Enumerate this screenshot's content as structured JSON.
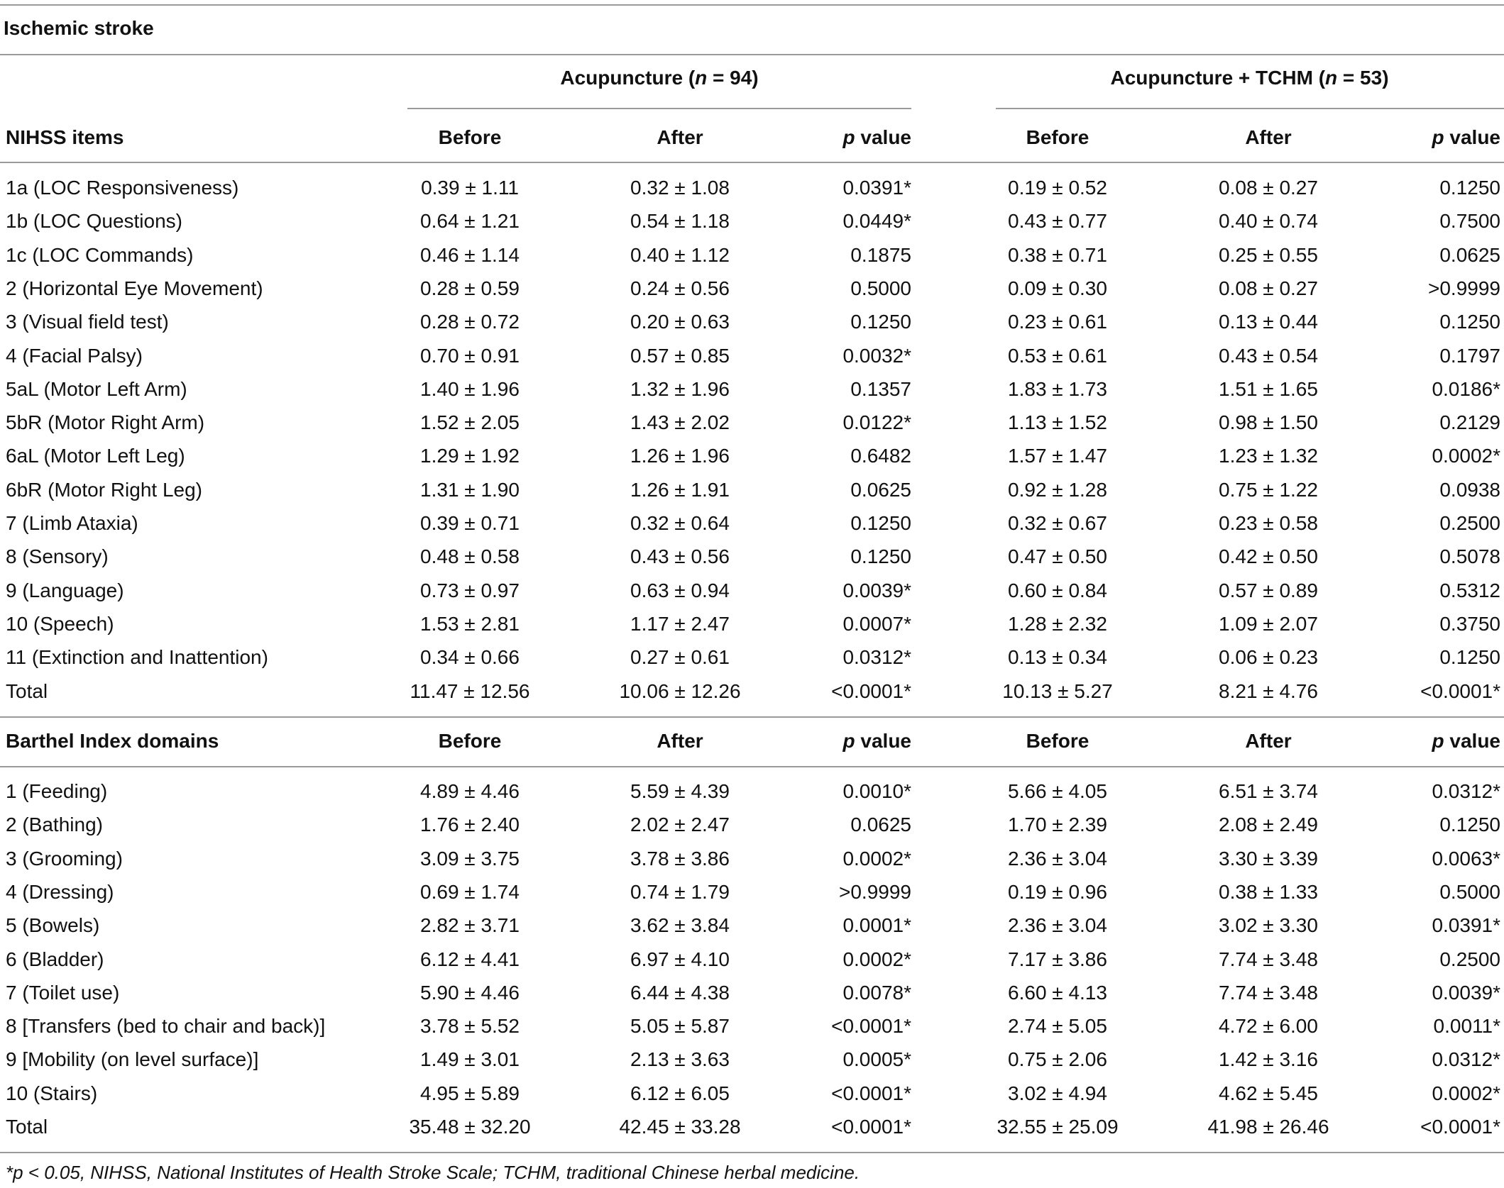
{
  "title": "Ischemic stroke",
  "groups": {
    "acupuncture": {
      "label": "Acupuncture (",
      "n_label": "n",
      "n_value": " = 94)"
    },
    "combo": {
      "label": "Acupuncture + TCHM (",
      "n_label": "n",
      "n_value": " = 53)"
    }
  },
  "nihss": {
    "section_label": "NIHSS items",
    "col_before": "Before",
    "col_after": "After",
    "col_p_italic": "p",
    "col_p_rest": " value",
    "rows": [
      {
        "item": "1a (LOC Responsiveness)",
        "a_before": "0.39 ± 1.11",
        "a_after": "0.32 ± 1.08",
        "a_p": "0.0391*",
        "c_before": "0.19 ± 0.52",
        "c_after": "0.08 ± 0.27",
        "c_p": "0.1250"
      },
      {
        "item": "1b (LOC Questions)",
        "a_before": "0.64 ± 1.21",
        "a_after": "0.54 ± 1.18",
        "a_p": "0.0449*",
        "c_before": "0.43 ± 0.77",
        "c_after": "0.40 ± 0.74",
        "c_p": "0.7500"
      },
      {
        "item": "1c (LOC Commands)",
        "a_before": "0.46 ± 1.14",
        "a_after": "0.40 ± 1.12",
        "a_p": "0.1875",
        "c_before": "0.38 ± 0.71",
        "c_after": "0.25 ± 0.55",
        "c_p": "0.0625"
      },
      {
        "item": "2 (Horizontal Eye Movement)",
        "a_before": "0.28 ± 0.59",
        "a_after": "0.24 ± 0.56",
        "a_p": "0.5000",
        "c_before": "0.09 ± 0.30",
        "c_after": "0.08 ± 0.27",
        "c_p": ">0.9999"
      },
      {
        "item": "3 (Visual field test)",
        "a_before": "0.28 ± 0.72",
        "a_after": "0.20 ± 0.63",
        "a_p": "0.1250",
        "c_before": "0.23 ± 0.61",
        "c_after": "0.13 ± 0.44",
        "c_p": "0.1250"
      },
      {
        "item": "4 (Facial Palsy)",
        "a_before": "0.70 ± 0.91",
        "a_after": "0.57 ± 0.85",
        "a_p": "0.0032*",
        "c_before": "0.53 ± 0.61",
        "c_after": "0.43 ± 0.54",
        "c_p": "0.1797"
      },
      {
        "item": "5aL (Motor Left Arm)",
        "a_before": "1.40 ± 1.96",
        "a_after": "1.32 ± 1.96",
        "a_p": "0.1357",
        "c_before": "1.83 ± 1.73",
        "c_after": "1.51 ± 1.65",
        "c_p": "0.0186*"
      },
      {
        "item": "5bR (Motor Right Arm)",
        "a_before": "1.52 ± 2.05",
        "a_after": "1.43 ± 2.02",
        "a_p": "0.0122*",
        "c_before": "1.13 ± 1.52",
        "c_after": "0.98 ± 1.50",
        "c_p": "0.2129"
      },
      {
        "item": "6aL (Motor Left Leg)",
        "a_before": "1.29 ± 1.92",
        "a_after": "1.26 ± 1.96",
        "a_p": "0.6482",
        "c_before": "1.57 ± 1.47",
        "c_after": "1.23 ± 1.32",
        "c_p": "0.0002*"
      },
      {
        "item": "6bR (Motor Right Leg)",
        "a_before": "1.31 ± 1.90",
        "a_after": "1.26 ± 1.91",
        "a_p": "0.0625",
        "c_before": "0.92 ± 1.28",
        "c_after": "0.75 ± 1.22",
        "c_p": "0.0938"
      },
      {
        "item": "7 (Limb Ataxia)",
        "a_before": "0.39 ± 0.71",
        "a_after": "0.32 ± 0.64",
        "a_p": "0.1250",
        "c_before": "0.32 ± 0.67",
        "c_after": "0.23 ± 0.58",
        "c_p": "0.2500"
      },
      {
        "item": "8 (Sensory)",
        "a_before": "0.48 ± 0.58",
        "a_after": "0.43 ± 0.56",
        "a_p": "0.1250",
        "c_before": "0.47 ± 0.50",
        "c_after": "0.42 ± 0.50",
        "c_p": "0.5078"
      },
      {
        "item": "9 (Language)",
        "a_before": "0.73 ± 0.97",
        "a_after": "0.63 ± 0.94",
        "a_p": "0.0039*",
        "c_before": "0.60 ± 0.84",
        "c_after": "0.57 ± 0.89",
        "c_p": "0.5312"
      },
      {
        "item": "10 (Speech)",
        "a_before": "1.53 ± 2.81",
        "a_after": "1.17 ± 2.47",
        "a_p": "0.0007*",
        "c_before": "1.28 ± 2.32",
        "c_after": "1.09 ± 2.07",
        "c_p": "0.3750"
      },
      {
        "item": "11 (Extinction and Inattention)",
        "a_before": "0.34 ± 0.66",
        "a_after": "0.27 ± 0.61",
        "a_p": "0.0312*",
        "c_before": "0.13 ± 0.34",
        "c_after": "0.06 ± 0.23",
        "c_p": "0.1250"
      },
      {
        "item": "Total",
        "a_before": "11.47 ± 12.56",
        "a_after": "10.06 ± 12.26",
        "a_p": "<0.0001*",
        "c_before": "10.13 ± 5.27",
        "c_after": "8.21 ± 4.76",
        "c_p": "<0.0001*"
      }
    ]
  },
  "barthel": {
    "section_label": "Barthel Index domains",
    "col_before": "Before",
    "col_after": "After",
    "col_p_italic": "p",
    "col_p_rest": " value",
    "rows": [
      {
        "item": "1 (Feeding)",
        "a_before": "4.89 ± 4.46",
        "a_after": "5.59 ± 4.39",
        "a_p": "0.0010*",
        "c_before": "5.66 ± 4.05",
        "c_after": "6.51 ± 3.74",
        "c_p": "0.0312*"
      },
      {
        "item": "2 (Bathing)",
        "a_before": "1.76 ± 2.40",
        "a_after": "2.02 ± 2.47",
        "a_p": "0.0625",
        "c_before": "1.70 ± 2.39",
        "c_after": "2.08 ± 2.49",
        "c_p": "0.1250"
      },
      {
        "item": "3 (Grooming)",
        "a_before": "3.09 ± 3.75",
        "a_after": "3.78 ± 3.86",
        "a_p": "0.0002*",
        "c_before": "2.36 ± 3.04",
        "c_after": "3.30 ± 3.39",
        "c_p": "0.0063*"
      },
      {
        "item": "4 (Dressing)",
        "a_before": "0.69 ± 1.74",
        "a_after": "0.74 ± 1.79",
        "a_p": ">0.9999",
        "c_before": "0.19 ± 0.96",
        "c_after": "0.38 ± 1.33",
        "c_p": "0.5000"
      },
      {
        "item": "5 (Bowels)",
        "a_before": "2.82 ± 3.71",
        "a_after": "3.62 ± 3.84",
        "a_p": "0.0001*",
        "c_before": "2.36 ± 3.04",
        "c_after": "3.02 ± 3.30",
        "c_p": "0.0391*"
      },
      {
        "item": "6 (Bladder)",
        "a_before": "6.12 ± 4.41",
        "a_after": "6.97 ± 4.10",
        "a_p": "0.0002*",
        "c_before": "7.17 ± 3.86",
        "c_after": "7.74 ± 3.48",
        "c_p": "0.2500"
      },
      {
        "item": "7 (Toilet use)",
        "a_before": "5.90 ± 4.46",
        "a_after": "6.44 ± 4.38",
        "a_p": "0.0078*",
        "c_before": "6.60 ± 4.13",
        "c_after": "7.74 ± 3.48",
        "c_p": "0.0039*"
      },
      {
        "item": "8 [Transfers (bed to chair and back)]",
        "a_before": "3.78 ± 5.52",
        "a_after": "5.05 ± 5.87",
        "a_p": "<0.0001*",
        "c_before": "2.74 ± 5.05",
        "c_after": "4.72 ± 6.00",
        "c_p": "0.0011*"
      },
      {
        "item": "9 [Mobility (on level surface)]",
        "a_before": "1.49 ± 3.01",
        "a_after": "2.13 ± 3.63",
        "a_p": "0.0005*",
        "c_before": "0.75 ± 2.06",
        "c_after": "1.42 ± 3.16",
        "c_p": "0.0312*"
      },
      {
        "item": "10 (Stairs)",
        "a_before": "4.95 ± 5.89",
        "a_after": "6.12 ± 6.05",
        "a_p": "<0.0001*",
        "c_before": "3.02 ± 4.94",
        "c_after": "4.62 ± 5.45",
        "c_p": "0.0002*"
      },
      {
        "item": "Total",
        "a_before": "35.48 ± 32.20",
        "a_after": "42.45 ± 33.28",
        "a_p": "<0.0001*",
        "c_before": "32.55 ± 25.09",
        "c_after": "41.98 ± 26.46",
        "c_p": "<0.0001*"
      }
    ]
  },
  "footnote": "*p < 0.05, NIHSS, National Institutes of Health Stroke Scale; TCHM, traditional Chinese herbal medicine."
}
